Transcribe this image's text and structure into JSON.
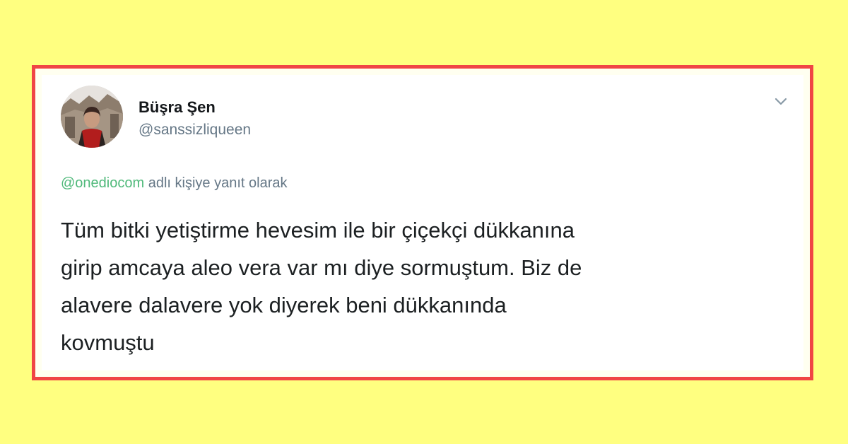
{
  "tweet": {
    "author": {
      "display_name": "Büşra Şen",
      "handle": "@sanssizliqueen",
      "avatar_icon": "profile-photo"
    },
    "reply_context": {
      "mention": "@onediocom",
      "suffix": "adlı kişiye yanıt olarak"
    },
    "text_lines": [
      "Tüm bitki yetiştirme hevesim ile bir çiçekçi dükkanına",
      "girip amcaya aleo vera var mı diye sormuştum. Biz de",
      "alavere dalavere yok diyerek beni dükkanında",
      "kovmuştu"
    ],
    "menu_icon": "chevron-down-icon"
  },
  "colors": {
    "background": "#ffff80",
    "frame_border": "#f04545",
    "mention": "#4fb97a",
    "secondary_text": "#657786",
    "primary_text": "#14171a"
  }
}
